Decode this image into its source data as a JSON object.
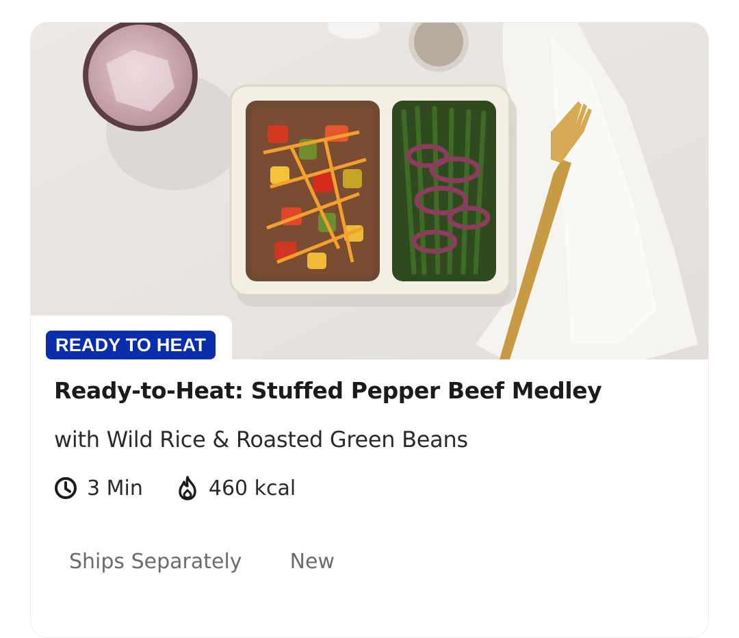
{
  "card": {
    "image_alt": "Stuffed pepper beef medley meal in a two-compartment container",
    "badge": "READY TO HEAT",
    "title": "Ready-to-Heat: Stuffed Pepper Beef Medley",
    "subtitle": "with Wild Rice & Roasted Green Beans",
    "meta": {
      "time_icon": "clock-icon",
      "time": "3 Min",
      "calories_icon": "flame-icon",
      "calories": "460 kcal"
    },
    "tags": [
      "Ships Separately",
      "New"
    ]
  },
  "colors": {
    "badge_bg": "#0a2dab",
    "badge_text": "#ffffff",
    "title_text": "#1b1b1b",
    "tag_text": "#6c6c6c"
  }
}
